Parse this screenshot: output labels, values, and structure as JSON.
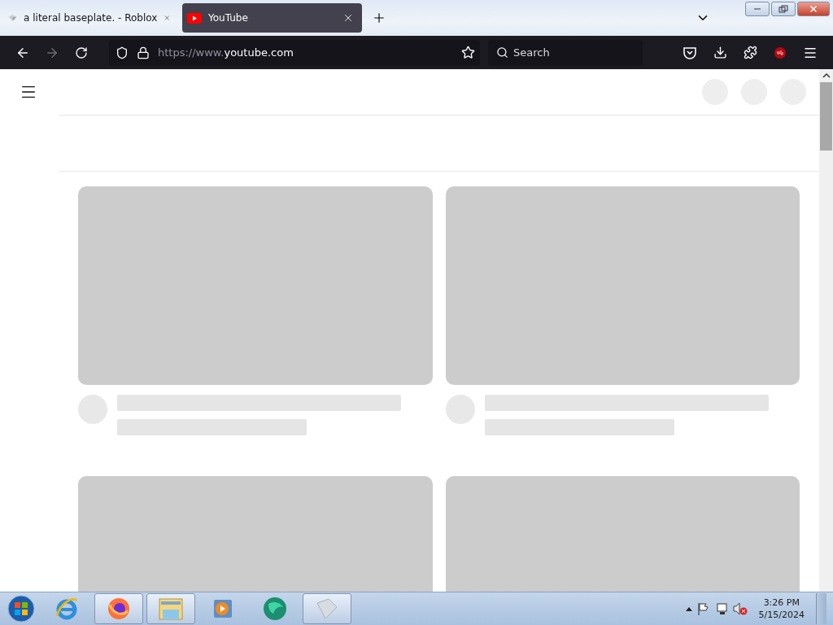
{
  "tabs": [
    {
      "title": "a literal baseplate. - Roblox",
      "kind": "roblox",
      "selected": false
    },
    {
      "title": "YouTube",
      "kind": "youtube",
      "selected": true
    }
  ],
  "address": {
    "url_prefix": "https://www.",
    "url_host": "youtube.com"
  },
  "search": {
    "placeholder": "Search"
  },
  "page": {
    "video_placeholders": [
      {
        "kind": "full"
      },
      {
        "kind": "full"
      },
      {
        "kind": "thumbnail"
      },
      {
        "kind": "thumbnail"
      }
    ]
  },
  "taskbar": {
    "apps": [
      {
        "kind": "ie",
        "open": false
      },
      {
        "kind": "firefox",
        "open": true
      },
      {
        "kind": "folder",
        "open": true
      },
      {
        "kind": "media",
        "open": false
      },
      {
        "kind": "globe",
        "open": false
      },
      {
        "kind": "roblox",
        "open": true
      }
    ],
    "clock": {
      "time": "3:26 PM",
      "date": "5/15/2024"
    }
  }
}
